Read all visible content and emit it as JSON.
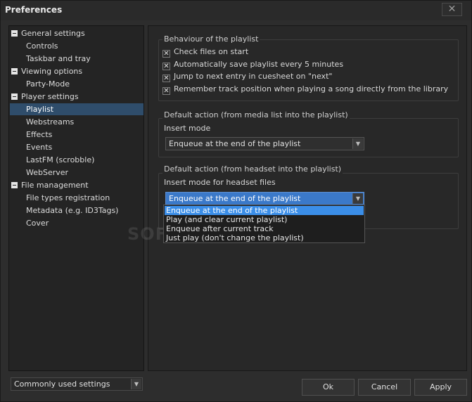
{
  "window": {
    "title": "Preferences",
    "close_label": "✕"
  },
  "tree": {
    "items": [
      {
        "label": "General settings",
        "level": 0
      },
      {
        "label": "Controls",
        "level": 1
      },
      {
        "label": "Taskbar and tray",
        "level": 1
      },
      {
        "label": "Viewing options",
        "level": 0
      },
      {
        "label": "Party-Mode",
        "level": 1
      },
      {
        "label": "Player settings",
        "level": 0
      },
      {
        "label": "Playlist",
        "level": 1,
        "selected": true
      },
      {
        "label": "Webstreams",
        "level": 1
      },
      {
        "label": "Effects",
        "level": 1
      },
      {
        "label": "Events",
        "level": 1
      },
      {
        "label": "LastFM (scrobble)",
        "level": 1
      },
      {
        "label": "WebServer",
        "level": 1
      },
      {
        "label": "File management",
        "level": 0
      },
      {
        "label": "File types registration",
        "level": 1
      },
      {
        "label": "Metadata (e.g. ID3Tags)",
        "level": 1
      },
      {
        "label": "Cover",
        "level": 1
      }
    ]
  },
  "behaviour": {
    "title": "Behaviour of the playlist",
    "checks": [
      {
        "label": "Check files on start",
        "checked": true
      },
      {
        "label": "Automatically save playlist every 5 minutes",
        "checked": true
      },
      {
        "label": "Jump to next entry in cuesheet on \"next\"",
        "checked": true
      },
      {
        "label": "Remember track position when playing a song directly from the library",
        "checked": true
      }
    ]
  },
  "media_action": {
    "title": "Default action (from media list into the playlist)",
    "mode_label": "Insert mode",
    "mode_value": "Enqueue at the end of the playlist"
  },
  "headset_action": {
    "title": "Default action (from headset into the playlist)",
    "mode_label": "Insert mode for headset files",
    "mode_value": "Enqueue at the end of the playlist",
    "options": [
      "Enqueue at the end of the playlist",
      "Play (and clear current playlist)",
      "Enqueue after current track",
      "Just play (don't change the playlist)"
    ]
  },
  "watermark": "SOFTPEDIA",
  "footer": {
    "settings_combo": "Commonly used settings",
    "ok": "Ok",
    "cancel": "Cancel",
    "apply": "Apply"
  },
  "colors": {
    "selection": "#2f4d6b",
    "highlight": "#3b8ee8",
    "background": "#2d2d2d"
  },
  "icons": {
    "collapse": "minus-box-icon",
    "checkmark": "x-check-icon",
    "combo_arrow": "chevron-down-icon"
  }
}
